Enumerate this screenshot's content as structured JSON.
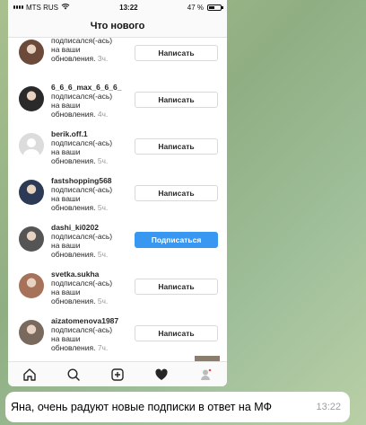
{
  "status_bar": {
    "carrier": "MTS RUS",
    "time": "13:22",
    "battery_percent": "47 %",
    "battery_level": 0.47
  },
  "header": {
    "title": "Что нового"
  },
  "activity": [
    {
      "username": "",
      "text_line1": "подписался(-ась)",
      "text_line2": "на ваши",
      "text_line3": "обновления.",
      "time": "3ч.",
      "button": "Написать",
      "button_style": "outline",
      "avatar_color": "#6b4a3a"
    },
    {
      "username": "6_6_6_max_6_6_6_",
      "text_line1": "подписался(-ась)",
      "text_line2": "на ваши",
      "text_line3": "обновления.",
      "time": "4ч.",
      "button": "Написать",
      "button_style": "outline",
      "avatar_color": "#2a2a2a"
    },
    {
      "username": "berik.off.1",
      "text_line1": "подписался(-ась)",
      "text_line2": "на ваши",
      "text_line3": "обновления.",
      "time": "5ч.",
      "button": "Написать",
      "button_style": "outline",
      "avatar_color": "placeholder"
    },
    {
      "username": "fastshopping568",
      "text_line1": "подписался(-ась)",
      "text_line2": "на ваши",
      "text_line3": "обновления.",
      "time": "5ч.",
      "button": "Написать",
      "button_style": "outline",
      "avatar_color": "#2d3a55"
    },
    {
      "username": "dashi_ki0202",
      "text_line1": "подписался(-ась)",
      "text_line2": "на ваши",
      "text_line3": "обновления.",
      "time": "5ч.",
      "button": "Подписаться",
      "button_style": "primary",
      "avatar_color": "#555555"
    },
    {
      "username": "svetka.sukha",
      "text_line1": "подписался(-ась)",
      "text_line2": "на ваши",
      "text_line3": "обновления.",
      "time": "5ч.",
      "button": "Написать",
      "button_style": "outline",
      "avatar_color": "#a7725a"
    },
    {
      "username": "aizatomenova1987",
      "text_line1": "подписался(-ась)",
      "text_line2": "на ваши",
      "text_line3": "обновления.",
      "time": "7ч.",
      "button": "Написать",
      "button_style": "outline",
      "avatar_color": "#7a6a5e"
    }
  ],
  "tabs": [
    {
      "icon": "home-icon"
    },
    {
      "icon": "search-icon"
    },
    {
      "icon": "add-post-icon"
    },
    {
      "icon": "heart-icon"
    },
    {
      "icon": "profile-icon"
    }
  ],
  "message": {
    "text": "Яна, очень радуют новые подписки в ответ на МФ",
    "time": "13:22"
  }
}
